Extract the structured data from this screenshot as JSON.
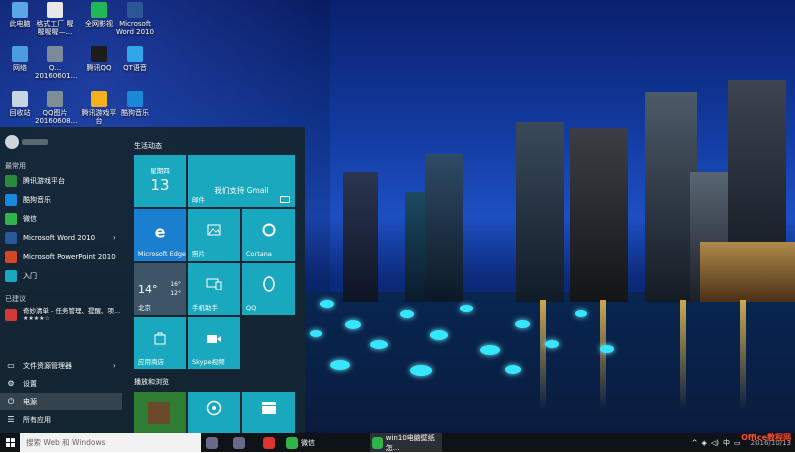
{
  "desktop": {
    "icons": [
      {
        "label": "此电脑",
        "icon": "computer-icon",
        "color": "#5aa6e6"
      },
      {
        "label": "格式工厂 喔喔喔喔—...",
        "icon": "format-factory-icon",
        "color": "#e8e8e8"
      },
      {
        "label": "全网影视",
        "icon": "video-app-icon",
        "color": "#1db954"
      },
      {
        "label": "Microsoft Word 2010",
        "icon": "word-icon",
        "color": "#2b5797"
      },
      {
        "label": "网络",
        "icon": "network-icon",
        "color": "#4d9be0"
      },
      {
        "label": "Q... 20160601...",
        "icon": "screenshot-file-icon",
        "color": "#7a8a9a"
      },
      {
        "label": "腾讯QQ",
        "icon": "qq-icon",
        "color": "#1c1c1c"
      },
      {
        "label": "QT语音",
        "icon": "qt-voice-icon",
        "color": "#2fa6e8"
      },
      {
        "label": "回收站",
        "icon": "recycle-bin-icon",
        "color": "#c6d6e4"
      },
      {
        "label": "QQ图片 20160608...",
        "icon": "image-file-icon",
        "color": "#7d8e96"
      },
      {
        "label": "腾讯游戏平台",
        "icon": "tencent-game-icon",
        "color": "#f3b21c"
      },
      {
        "label": "酷狗音乐",
        "icon": "kugou-icon",
        "color": "#1a88d9"
      }
    ]
  },
  "start_menu": {
    "most_used_label": "最常用",
    "apps": [
      {
        "label": "腾讯游戏平台",
        "icon": "tencent-game-icon",
        "color": "#2a8a3c",
        "chevron": ""
      },
      {
        "label": "酷狗音乐",
        "icon": "kugou-icon",
        "color": "#1a88d9",
        "chevron": ""
      },
      {
        "label": "微信",
        "icon": "wechat-icon",
        "color": "#2fb34a",
        "chevron": ""
      },
      {
        "label": "Microsoft Word 2010",
        "icon": "word-icon",
        "color": "#2b5797",
        "chevron": "›"
      },
      {
        "label": "Microsoft PowerPoint 2010",
        "icon": "powerpoint-icon",
        "color": "#d24726",
        "chevron": ""
      },
      {
        "label": "入门",
        "icon": "lightbulb-icon",
        "color": "#1aa8bf",
        "chevron": ""
      }
    ],
    "suggested_label": "已建议",
    "suggested_app": {
      "label": "奇妙清单 - 任务管理、提醒、项...",
      "rating": "★★★★☆",
      "icon": "wunderlist-icon",
      "color": "#d23a3a"
    },
    "bottom_items": [
      {
        "label": "文件资源管理器",
        "icon": "folder-icon",
        "chevron": "›"
      },
      {
        "label": "设置",
        "icon": "gear-icon",
        "chevron": ""
      },
      {
        "label": "电源",
        "icon": "power-icon",
        "chevron": ""
      },
      {
        "label": "所有应用",
        "icon": "list-icon",
        "chevron": ""
      }
    ],
    "tiles_header": "生活动态",
    "play_header": "播放和浏览",
    "tiles": {
      "calendar_day": "星期四",
      "calendar_date": "13",
      "mail_title": "我们支持 Gmail",
      "mail_label": "邮件",
      "edge_label": "Microsoft Edge",
      "photos_label": "照片",
      "cortana_label": "Cortana",
      "weather_temp": "14°",
      "weather_high": "16°",
      "weather_low": "12°",
      "weather_city": "北京",
      "phone_label": "手机助手",
      "qq_label": "QQ",
      "store_label": "应用商店",
      "skype_label": "Skype视频"
    }
  },
  "taskbar": {
    "search_placeholder": "搜索 Web 和 Windows",
    "items": [
      {
        "label": "",
        "icon": "app-icon-1",
        "color": "#6a6a88"
      },
      {
        "label": "",
        "icon": "app-icon-2",
        "color": "#6a6a88"
      },
      {
        "label": "",
        "icon": "game-icon",
        "color": "#d33"
      },
      {
        "label": "微信",
        "icon": "wechat-icon",
        "color": "#2fb34a"
      },
      {
        "label": "win10电脑壁纸怎...",
        "icon": "browser-icon",
        "color": "#2fb34a"
      }
    ],
    "tray_date": "2016/10/13",
    "watermark": "Office教程网"
  },
  "colors": {
    "tile": "#1aa8bf",
    "start_bg": "#142630",
    "taskbar": "#0f1318"
  }
}
